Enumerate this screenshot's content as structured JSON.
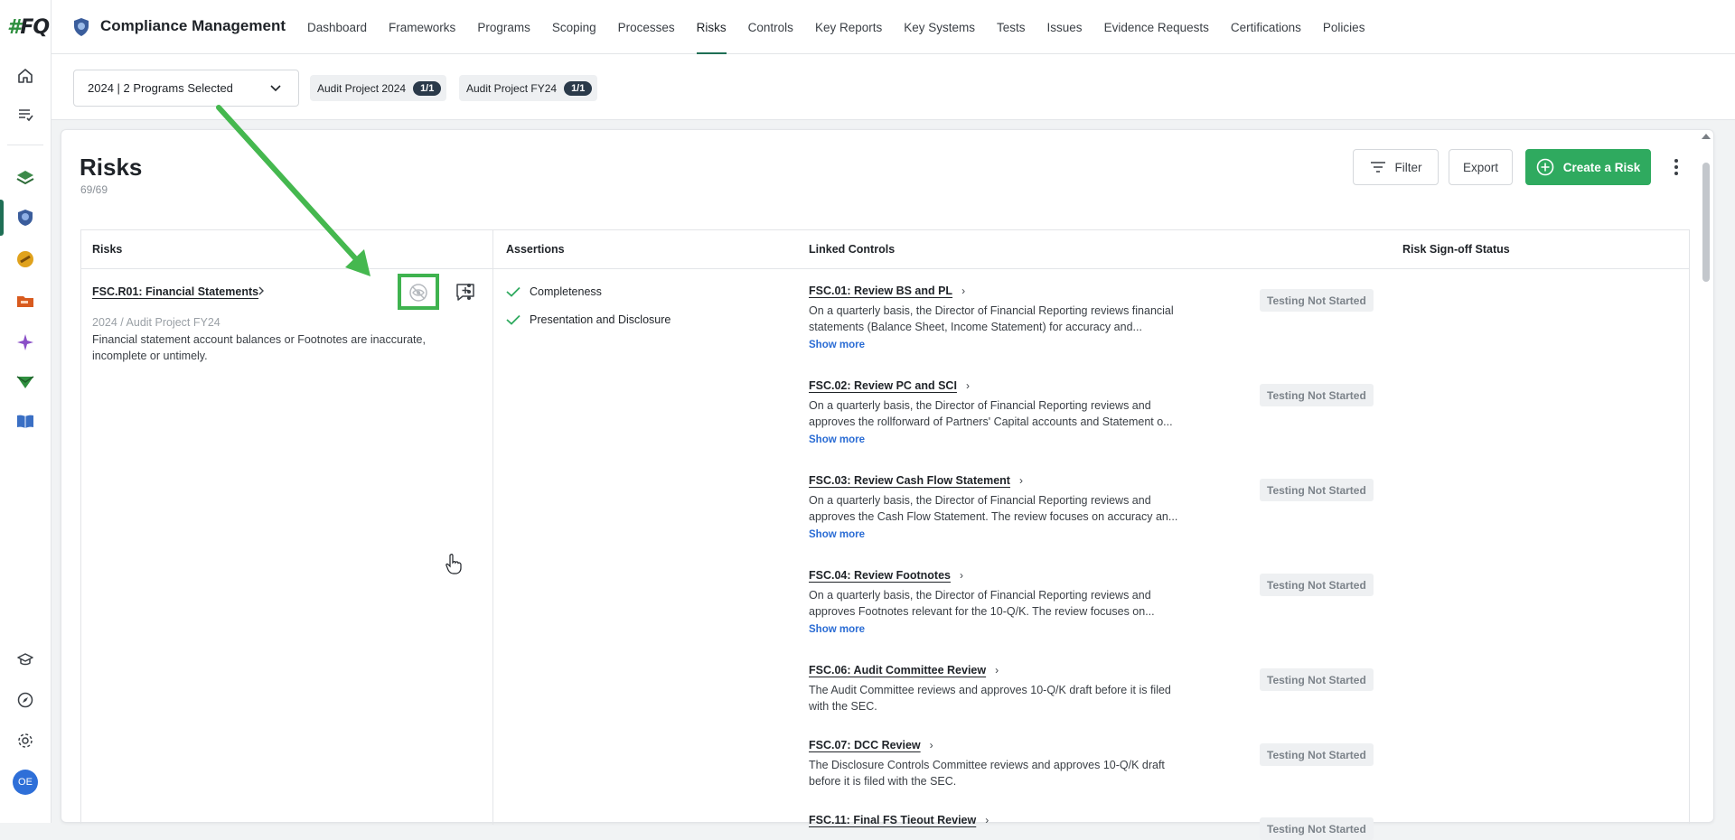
{
  "rail": {
    "logo_hash": "#",
    "logo_text": "FQ",
    "avatar_initials": "OE"
  },
  "topnav": {
    "app_title": "Compliance Management",
    "items": [
      "Dashboard",
      "Frameworks",
      "Programs",
      "Scoping",
      "Processes",
      "Risks",
      "Controls",
      "Key Reports",
      "Key Systems",
      "Tests",
      "Issues",
      "Evidence Requests",
      "Certifications",
      "Policies"
    ],
    "active": "Risks"
  },
  "program_bar": {
    "selected": "2024 | 2 Programs Selected",
    "chips": [
      {
        "label": "Audit Project 2024",
        "count": "1/1"
      },
      {
        "label": "Audit Project FY24",
        "count": "1/1"
      }
    ]
  },
  "page": {
    "title": "Risks",
    "count": "69/69",
    "filter_label": "Filter",
    "export_label": "Export",
    "create_label": "Create a Risk"
  },
  "table": {
    "headers": {
      "risks": "Risks",
      "assertions": "Assertions",
      "linked_controls": "Linked Controls",
      "signoff": "Risk Sign-off Status"
    },
    "risk": {
      "name": "FSC.R01: Financial Statements",
      "meta": "2024 / Audit Project FY24",
      "desc_line1": "Financial statement account balances or Footnotes are inaccurate,",
      "desc_line2": "incomplete or untimely."
    },
    "assertions": [
      "Completeness",
      "Presentation and Disclosure"
    ],
    "show_more": "Show more",
    "controls": [
      {
        "title": "FSC.01: Review BS and PL",
        "line1": "On a quarterly basis, the Director of Financial Reporting reviews financial",
        "line2": "statements (Balance Sheet, Income Statement) for accuracy and...",
        "show_more": true,
        "status": "Testing Not Started"
      },
      {
        "title": "FSC.02: Review PC and SCI",
        "line1": "On a quarterly basis, the Director of Financial Reporting reviews and",
        "line2": "approves the rollforward of Partners' Capital accounts and Statement o...",
        "show_more": true,
        "status": "Testing Not Started"
      },
      {
        "title": "FSC.03: Review Cash Flow Statement",
        "line1": "On a quarterly basis, the Director of Financial Reporting reviews and",
        "line2": "approves the Cash Flow Statement. The review focuses on accuracy an...",
        "show_more": true,
        "status": "Testing Not Started"
      },
      {
        "title": "FSC.04: Review Footnotes",
        "line1": "On a quarterly basis, the Director of Financial Reporting reviews and",
        "line2": "approves Footnotes relevant for the 10-Q/K. The review focuses on...",
        "show_more": true,
        "status": "Testing Not Started"
      },
      {
        "title": "FSC.06: Audit Committee Review",
        "line1": "The Audit Committee reviews and approves 10-Q/K draft before it is filed",
        "line2": "with the SEC.",
        "show_more": false,
        "status": "Testing Not Started"
      },
      {
        "title": "FSC.07: DCC Review",
        "line1": "The Disclosure Controls Committee reviews and approves 10-Q/K draft",
        "line2": "before it is filed with the SEC.",
        "show_more": false,
        "status": "Testing Not Started"
      },
      {
        "title": "FSC.11: Final FS Tieout Review",
        "line1": "",
        "line2": "",
        "show_more": false,
        "status": "Testing Not Started"
      }
    ]
  },
  "colors": {
    "accent": "#1f6f55",
    "primary_button": "#2faa5f",
    "highlight": "#3fb34f",
    "link": "#2a6cd4"
  }
}
